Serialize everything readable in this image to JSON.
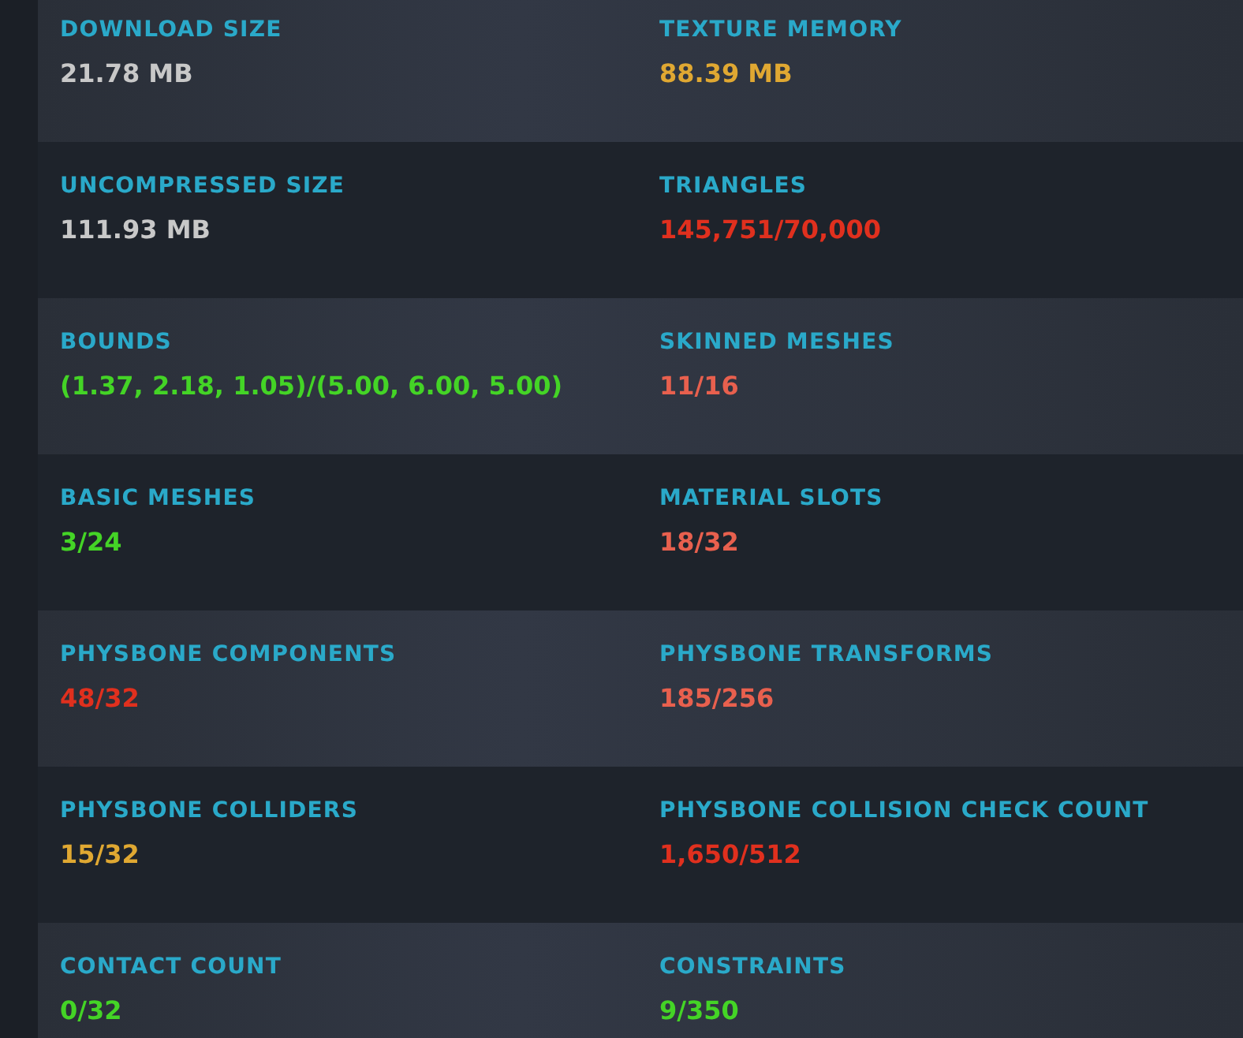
{
  "rows": [
    {
      "cells": [
        {
          "label": "DOWNLOAD SIZE",
          "value": "21.78 MB",
          "color": "#c8c8c8"
        },
        {
          "label": "TEXTURE MEMORY",
          "value": "88.39 MB",
          "color": "#e0a832"
        }
      ]
    },
    {
      "cells": [
        {
          "label": "UNCOMPRESSED SIZE",
          "value": "111.93 MB",
          "color": "#c8c8c8"
        },
        {
          "label": "TRIANGLES",
          "value": "145,751/70,000",
          "color": "#e0301e"
        }
      ]
    },
    {
      "cells": [
        {
          "label": "BOUNDS",
          "value": "(1.37, 2.18, 1.05)/(5.00, 6.00, 5.00)",
          "color": "#44d426"
        },
        {
          "label": "SKINNED MESHES",
          "value": "11/16",
          "color": "#e8604e"
        }
      ]
    },
    {
      "cells": [
        {
          "label": "BASIC MESHES",
          "value": "3/24",
          "color": "#44d426"
        },
        {
          "label": "MATERIAL SLOTS",
          "value": "18/32",
          "color": "#e8604e"
        }
      ]
    },
    {
      "cells": [
        {
          "label": "PHYSBONE COMPONENTS",
          "value": "48/32",
          "color": "#e0301e"
        },
        {
          "label": "PHYSBONE TRANSFORMS",
          "value": "185/256",
          "color": "#e8604e"
        }
      ]
    },
    {
      "cells": [
        {
          "label": "PHYSBONE COLLIDERS",
          "value": "15/32",
          "color": "#e0a832"
        },
        {
          "label": "PHYSBONE COLLISION CHECK COUNT",
          "value": "1,650/512",
          "color": "#e0301e"
        }
      ]
    },
    {
      "cells": [
        {
          "label": "CONTACT COUNT",
          "value": "0/32",
          "color": "#44d426"
        },
        {
          "label": "CONSTRAINTS",
          "value": "9/350",
          "color": "#44d426"
        }
      ]
    }
  ]
}
